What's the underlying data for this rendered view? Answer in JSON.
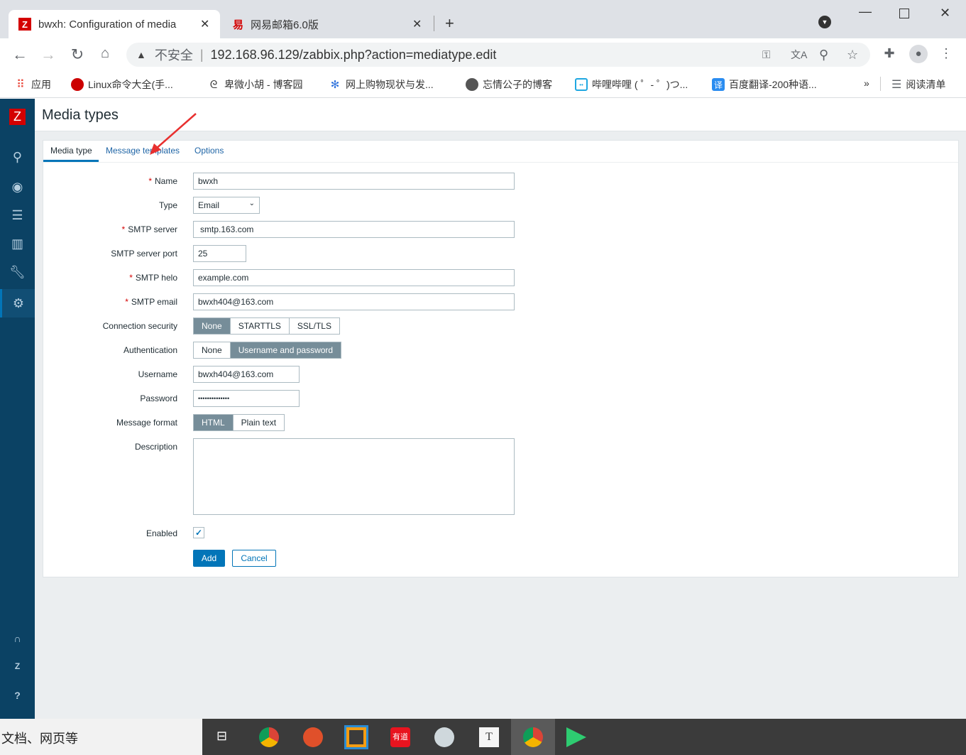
{
  "browser": {
    "tabs": [
      {
        "title": "bwxh: Configuration of media",
        "active": true
      },
      {
        "title": "网易邮箱6.0版",
        "active": false
      }
    ],
    "url_warning": "不安全",
    "url": "192.168.96.129/zabbix.php?action=mediatype.edit",
    "bookmarks": [
      "应用",
      "Linux命令大全(手...",
      "卑微小胡 - 博客园",
      "网上购物现状与发...",
      "忘情公子的博客",
      "哔哩哔哩 ( ゜- ゜)つ...",
      "百度翻译-200种语..."
    ],
    "bookmarks_overflow": "»",
    "reading_list": "阅读清单"
  },
  "page": {
    "title": "Media types",
    "tabs": [
      "Media type",
      "Message templates",
      "Options"
    ],
    "form": {
      "name_label": "Name",
      "name": "bwxh",
      "type_label": "Type",
      "type": "Email",
      "smtp_server_label": "SMTP server",
      "smtp_server": "smtp.163.com",
      "smtp_port_label": "SMTP server port",
      "smtp_port": "25",
      "smtp_helo_label": "SMTP helo",
      "smtp_helo": "example.com",
      "smtp_email_label": "SMTP email",
      "smtp_email": "bwxh404@163.com",
      "conn_security_label": "Connection security",
      "conn_security_options": [
        "None",
        "STARTTLS",
        "SSL/TLS"
      ],
      "conn_security_selected": "None",
      "auth_label": "Authentication",
      "auth_options": [
        "None",
        "Username and password"
      ],
      "auth_selected": "Username and password",
      "username_label": "Username",
      "username": "bwxh404@163.com",
      "password_label": "Password",
      "password": "••••••••••••••",
      "msg_format_label": "Message format",
      "msg_format_options": [
        "HTML",
        "Plain text"
      ],
      "msg_format_selected": "HTML",
      "description_label": "Description",
      "description": "",
      "enabled_label": "Enabled",
      "enabled": true,
      "add": "Add",
      "cancel": "Cancel"
    }
  },
  "taskbar": {
    "search_text": "文档、网页等"
  },
  "colors": {
    "sidebar": "#0b4264",
    "accent": "#0275b8",
    "segment_on": "#768d99",
    "required": "#d40000"
  }
}
